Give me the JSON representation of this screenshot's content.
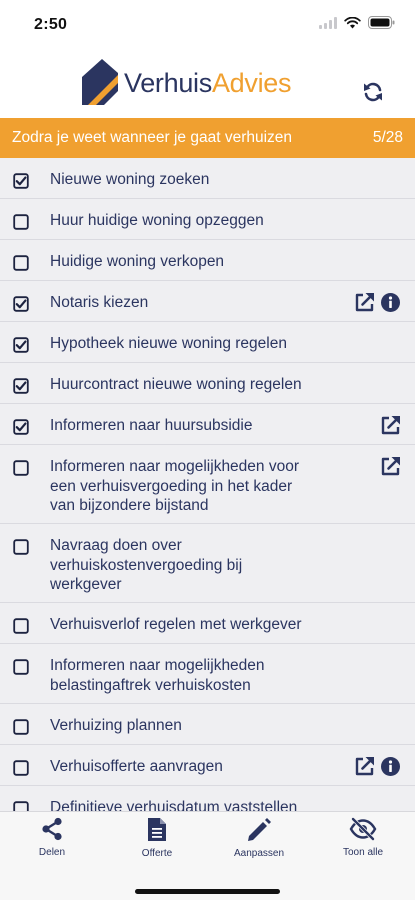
{
  "status_bar": {
    "time": "2:50"
  },
  "header": {
    "logo_part1": "Verhuis",
    "logo_part2": "Advies",
    "colors": {
      "brand_blue": "#2b3560",
      "brand_orange": "#f0a030"
    },
    "refresh_icon": "refresh-icon"
  },
  "banner": {
    "title": "Zodra je weet wanneer je gaat verhuizen",
    "progress": "5/28"
  },
  "items": [
    {
      "lines": [
        "Nieuwe woning zoeken"
      ],
      "checked": true,
      "link": false,
      "info": false
    },
    {
      "lines": [
        "Huur huidige woning opzeggen"
      ],
      "checked": false,
      "link": false,
      "info": false
    },
    {
      "lines": [
        "Huidige woning verkopen"
      ],
      "checked": false,
      "link": false,
      "info": false
    },
    {
      "lines": [
        "Notaris kiezen"
      ],
      "checked": true,
      "link": true,
      "info": true
    },
    {
      "lines": [
        "Hypotheek nieuwe woning regelen"
      ],
      "checked": true,
      "link": false,
      "info": false
    },
    {
      "lines": [
        "Huurcontract nieuwe woning regelen"
      ],
      "checked": true,
      "link": false,
      "info": false
    },
    {
      "lines": [
        "Informeren naar huursubsidie"
      ],
      "checked": true,
      "link": true,
      "info": false
    },
    {
      "lines": [
        "Informeren naar mogelijkheden voor",
        "een verhuisvergoeding in het kader",
        "van bijzondere bijstand"
      ],
      "checked": false,
      "link": true,
      "info": false
    },
    {
      "lines": [
        "Navraag doen over",
        "verhuiskostenvergoeding bij",
        "werkgever"
      ],
      "checked": false,
      "link": false,
      "info": false
    },
    {
      "lines": [
        "Verhuisverlof regelen met werkgever"
      ],
      "checked": false,
      "link": false,
      "info": false
    },
    {
      "lines": [
        "Informeren naar mogelijkheden",
        "belastingaftrek verhuiskosten"
      ],
      "checked": false,
      "link": false,
      "info": false
    },
    {
      "lines": [
        "Verhuizing plannen"
      ],
      "checked": false,
      "link": false,
      "info": false
    },
    {
      "lines": [
        "Verhuisofferte aanvragen"
      ],
      "checked": false,
      "link": true,
      "info": true
    },
    {
      "lines": [
        "Definitieve verhuisdatum vaststellen"
      ],
      "checked": false,
      "link": false,
      "info": false
    }
  ],
  "tabs": [
    {
      "label": "Delen",
      "icon": "share-icon"
    },
    {
      "label": "Offerte",
      "icon": "document-icon"
    },
    {
      "label": "Aanpassen",
      "icon": "pencil-icon"
    },
    {
      "label": "Toon alle",
      "icon": "eye-slash-icon"
    }
  ]
}
